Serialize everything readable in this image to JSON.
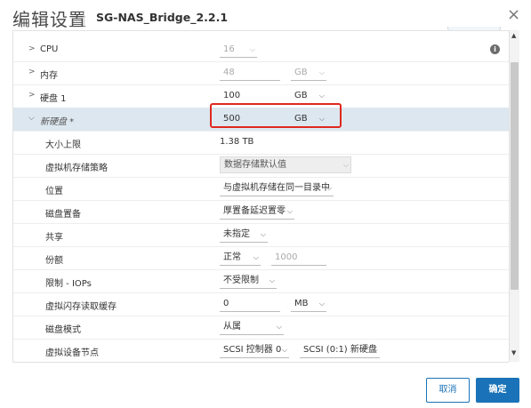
{
  "header": {
    "title": "编辑设置",
    "subtitle": "SG-NAS_Bridge_2.2.1",
    "close_icon": "×"
  },
  "rows": {
    "cpu": {
      "label": "CPU",
      "value": "16"
    },
    "memory": {
      "label": "内存",
      "value": "48",
      "unit": "GB"
    },
    "disk1": {
      "label": "硬盘 1",
      "value": "100",
      "unit": "GB"
    },
    "newdisk": {
      "label": "新硬盘 *",
      "value": "500",
      "unit": "GB"
    },
    "max_size": {
      "label": "大小上限",
      "value": "1.38 TB"
    },
    "storage_policy": {
      "label": "虚拟机存储策略",
      "value": "数据存储默认值"
    },
    "location": {
      "label": "位置",
      "value": "与虚拟机存储在同一目录中"
    },
    "provisioning": {
      "label": "磁盘置备",
      "value": "厚置备延迟置零"
    },
    "sharing": {
      "label": "共享",
      "value": "未指定"
    },
    "shares": {
      "label": "份额",
      "value": "正常",
      "number": "1000"
    },
    "limit_iops": {
      "label": "限制 - IOPs",
      "value": "不受限制"
    },
    "flash_cache": {
      "label": "虚拟闪存读取缓存",
      "value": "0",
      "unit": "MB"
    },
    "disk_mode": {
      "label": "磁盘模式",
      "value": "从属"
    },
    "device_node": {
      "label": "虚拟设备节点",
      "controller": "SCSI 控制器 0",
      "node": "SCSI (0:1) 新硬盘"
    }
  },
  "footer": {
    "cancel_label": "取消",
    "ok_label": "确定"
  },
  "colors": {
    "accent": "#1a73b8",
    "highlight_row": "#dde7f0",
    "red_annotation": "#e0281e"
  }
}
